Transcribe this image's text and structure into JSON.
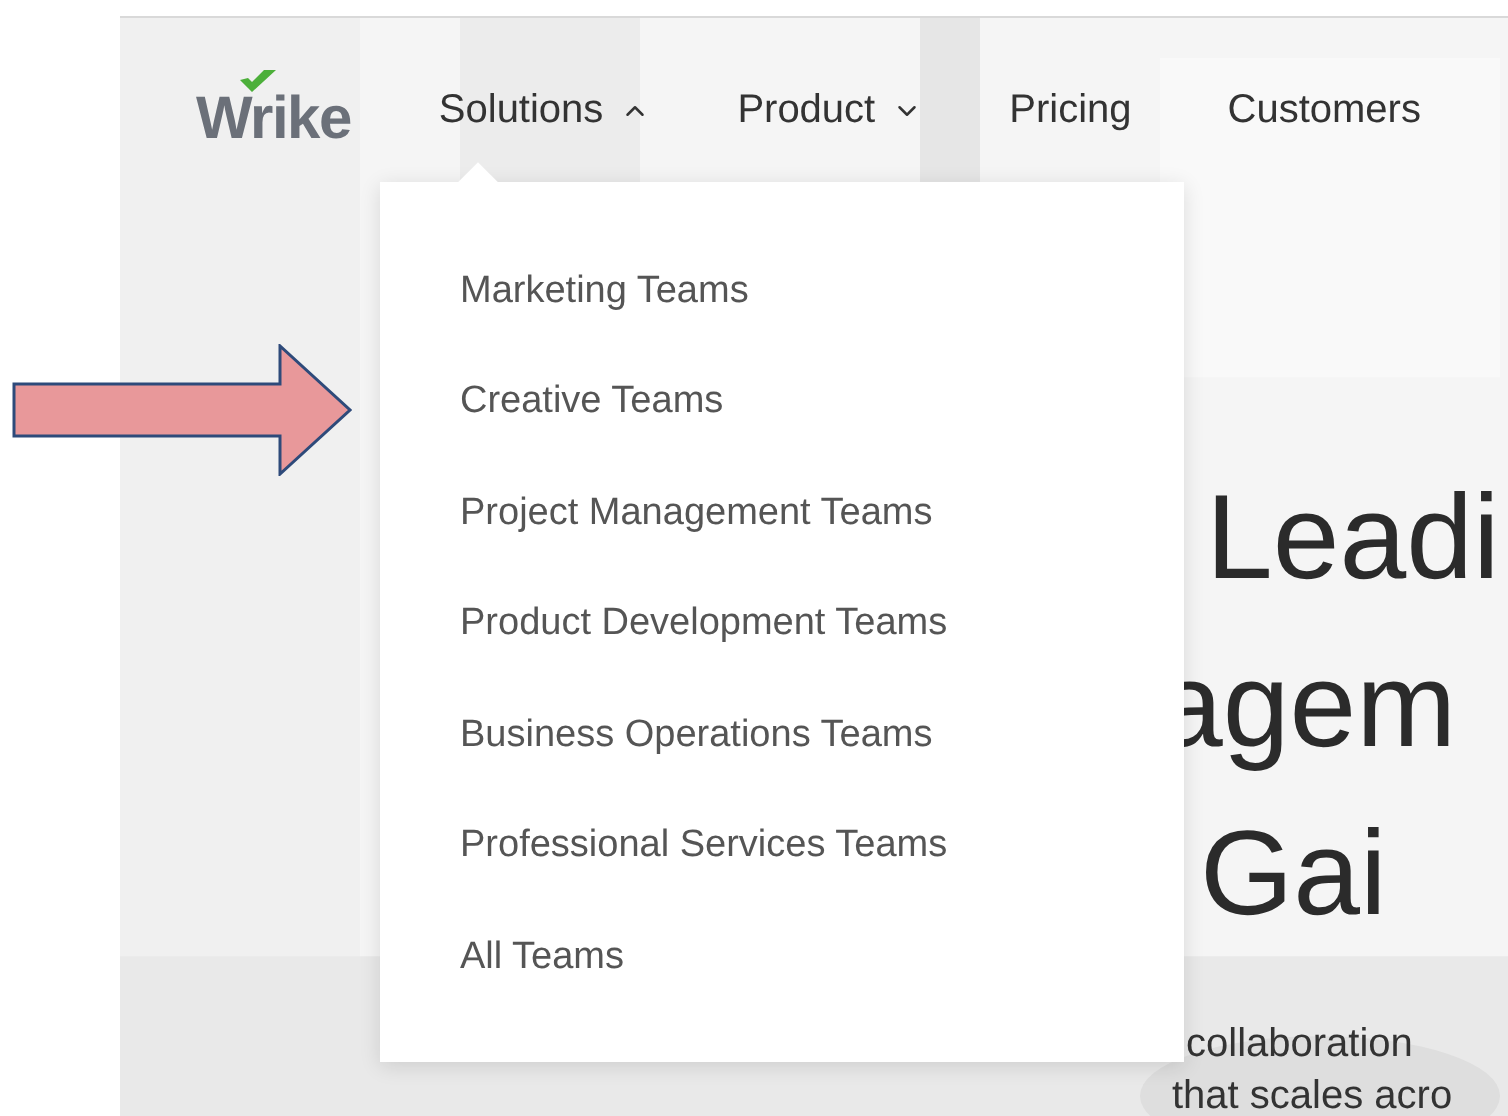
{
  "logo": {
    "text": "Wrike"
  },
  "nav": [
    {
      "label": "Solutions",
      "kind": "dropdown",
      "expanded": true
    },
    {
      "label": "Product",
      "kind": "dropdown",
      "expanded": false
    },
    {
      "label": "Pricing",
      "kind": "link"
    },
    {
      "label": "Customers",
      "kind": "link"
    }
  ],
  "solutions_menu": {
    "items": [
      "Marketing Teams",
      "Creative Teams",
      "Project Management Teams",
      "Product Development Teams",
      "Business Operations Teams",
      "Professional Services Teams",
      "All Teams"
    ]
  },
  "hero": {
    "headline_lines": [
      "Leadi",
      "agem",
      "Gai"
    ],
    "subtitle_lines": [
      "collaboration",
      "that scales acro"
    ]
  },
  "annotation": {
    "kind": "arrow"
  }
}
